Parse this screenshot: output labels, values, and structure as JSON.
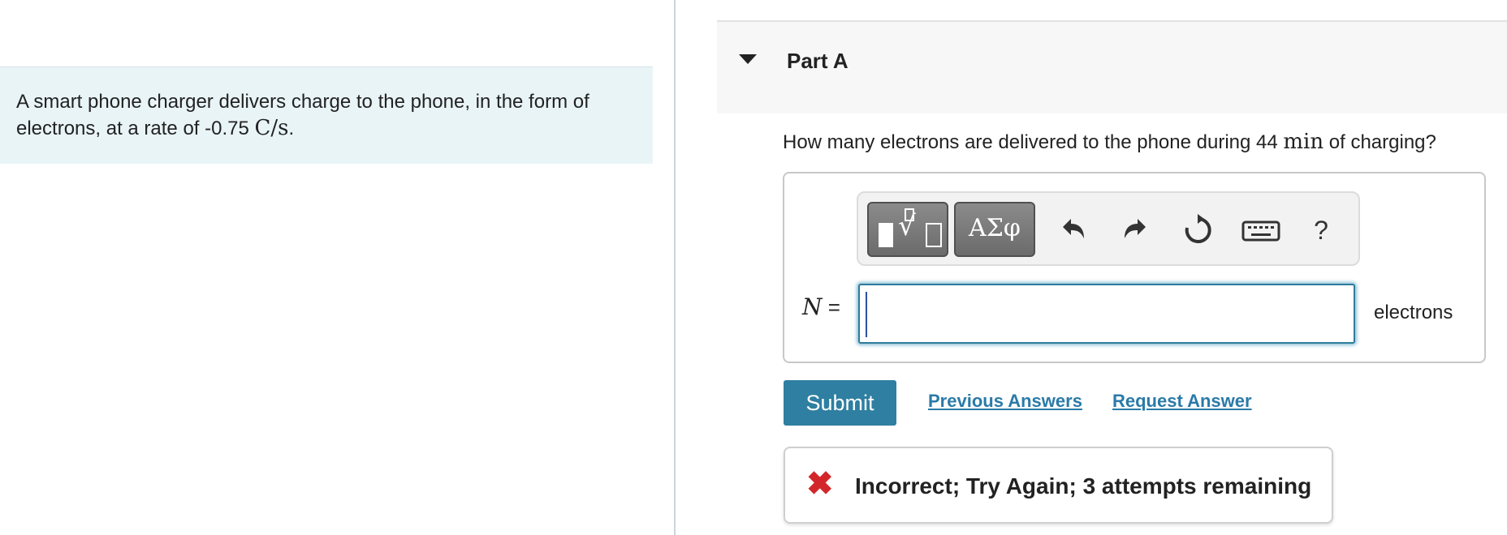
{
  "intro": {
    "text_before": "A smart phone charger delivers charge to the phone, in the form of electrons, at a rate of -0.75 ",
    "rate_unit": "C/s",
    "text_after": "."
  },
  "part": {
    "title": "Part A",
    "collapse_icon": "caret-down-icon"
  },
  "question": {
    "text_before": "How many electrons are delivered to the phone during 44 ",
    "time_unit": "min",
    "text_after": " of charging?"
  },
  "toolbar": {
    "templates_icon": "templates-icon",
    "greek_label": "ΑΣφ",
    "undo_icon": "undo-icon",
    "redo_icon": "redo-icon",
    "reset_icon": "reset-icon",
    "keyboard_icon": "keyboard-icon",
    "help_label": "?"
  },
  "answer": {
    "variable": "N",
    "equals": "=",
    "value": "",
    "unit": "electrons"
  },
  "actions": {
    "submit_label": "Submit",
    "previous_answers_label": "Previous Answers",
    "request_answer_label": "Request Answer"
  },
  "feedback": {
    "icon": "x-icon",
    "message": "Incorrect; Try Again; 3 attempts remaining",
    "color": "#d3262b"
  },
  "colors": {
    "accent": "#2e7fa1",
    "intro_bg": "#e9f4f7",
    "link": "#2a7aa8"
  }
}
